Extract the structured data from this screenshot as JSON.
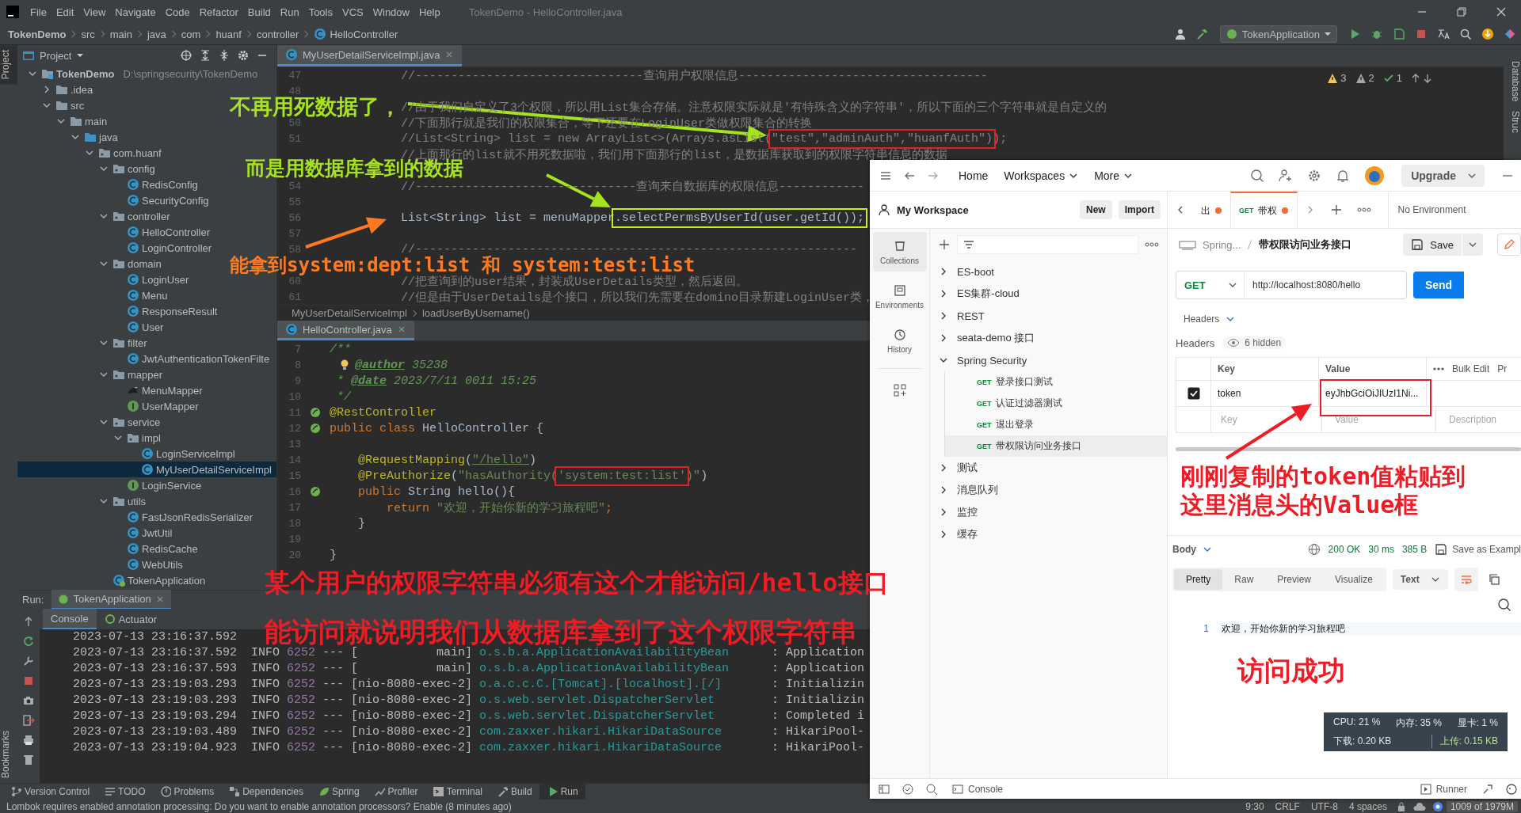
{
  "ide": {
    "menu": [
      "File",
      "Edit",
      "View",
      "Navigate",
      "Code",
      "Refactor",
      "Build",
      "Run",
      "Tools",
      "VCS",
      "Window",
      "Help"
    ],
    "window_title": "TokenDemo - HelloController.java",
    "breadcrumb": [
      "TokenDemo",
      "src",
      "main",
      "java",
      "com",
      "huanf",
      "controller",
      "HelloController"
    ],
    "run_config": "TokenApplication",
    "left_stripe": [
      {
        "label": "Project",
        "selected": true
      },
      {
        "label": "Bookmarks",
        "selected": false
      }
    ],
    "right_stripe": [
      "Database",
      "Struc"
    ],
    "project_panel": {
      "title": "Project",
      "tree": [
        {
          "name": "TokenDemo",
          "path": "D:\\springsecurity\\TokenDemo",
          "kind": "module",
          "expanded": true,
          "selected": false,
          "children": [
            {
              "name": ".idea",
              "kind": "folder",
              "expanded": false,
              "selected": false
            },
            {
              "name": "src",
              "kind": "folder",
              "expanded": true,
              "selected": false,
              "children": [
                {
                  "name": "main",
                  "kind": "folder",
                  "expanded": true,
                  "selected": false,
                  "children": [
                    {
                      "name": "java",
                      "kind": "source",
                      "expanded": true,
                      "selected": false,
                      "children": [
                        {
                          "name": "com.huanf",
                          "kind": "package",
                          "expanded": true,
                          "selected": false,
                          "children": [
                            {
                              "name": "config",
                              "kind": "package",
                              "expanded": true,
                              "selected": false,
                              "children": [
                                {
                                  "name": "RedisConfig",
                                  "kind": "class",
                                  "selected": false
                                },
                                {
                                  "name": "SecurityConfig",
                                  "kind": "class",
                                  "selected": false
                                }
                              ]
                            },
                            {
                              "name": "controller",
                              "kind": "package",
                              "expanded": true,
                              "selected": false,
                              "children": [
                                {
                                  "name": "HelloController",
                                  "kind": "class",
                                  "selected": false
                                },
                                {
                                  "name": "LoginController",
                                  "kind": "class",
                                  "selected": false
                                }
                              ]
                            },
                            {
                              "name": "domain",
                              "kind": "package",
                              "expanded": true,
                              "selected": false,
                              "children": [
                                {
                                  "name": "LoginUser",
                                  "kind": "class",
                                  "selected": false
                                },
                                {
                                  "name": "Menu",
                                  "kind": "class",
                                  "selected": false
                                },
                                {
                                  "name": "ResponseResult",
                                  "kind": "class",
                                  "selected": false
                                },
                                {
                                  "name": "User",
                                  "kind": "class",
                                  "selected": false
                                }
                              ]
                            },
                            {
                              "name": "filter",
                              "kind": "package",
                              "expanded": true,
                              "selected": false,
                              "children": [
                                {
                                  "name": "JwtAuthenticationTokenFilte",
                                  "kind": "class",
                                  "selected": false
                                }
                              ]
                            },
                            {
                              "name": "mapper",
                              "kind": "package",
                              "expanded": true,
                              "selected": false,
                              "children": [
                                {
                                  "name": "MenuMapper",
                                  "kind": "mapper",
                                  "selected": false
                                },
                                {
                                  "name": "UserMapper",
                                  "kind": "interface",
                                  "selected": false
                                }
                              ]
                            },
                            {
                              "name": "service",
                              "kind": "package",
                              "expanded": true,
                              "selected": false,
                              "children": [
                                {
                                  "name": "impl",
                                  "kind": "package",
                                  "expanded": true,
                                  "selected": false,
                                  "children": [
                                    {
                                      "name": "LoginServiceImpl",
                                      "kind": "class",
                                      "selected": false
                                    },
                                    {
                                      "name": "MyUserDetailServiceImpl",
                                      "kind": "class",
                                      "selected": true
                                    }
                                  ]
                                },
                                {
                                  "name": "LoginService",
                                  "kind": "interface",
                                  "selected": false
                                }
                              ]
                            },
                            {
                              "name": "utils",
                              "kind": "package",
                              "expanded": true,
                              "selected": false,
                              "children": [
                                {
                                  "name": "FastJsonRedisSerializer",
                                  "kind": "class",
                                  "selected": false
                                },
                                {
                                  "name": "JwtUtil",
                                  "kind": "class",
                                  "selected": false
                                },
                                {
                                  "name": "RedisCache",
                                  "kind": "class",
                                  "selected": false
                                },
                                {
                                  "name": "WebUtils",
                                  "kind": "class",
                                  "selected": false
                                }
                              ]
                            },
                            {
                              "name": "TokenApplication",
                              "kind": "app",
                              "selected": false
                            }
                          ]
                        }
                      ]
                    }
                  ]
                }
              ]
            }
          ]
        }
      ]
    },
    "editors": [
      {
        "tab": "MyUserDetailServiceImpl.java",
        "inspections": [
          {
            "kind": "warning",
            "count": "3"
          },
          {
            "kind": "weak",
            "count": "2"
          },
          {
            "kind": "ok",
            "count": "1"
          }
        ],
        "breadcrumb": [
          "MyUserDetailServiceImpl",
          "loadUserByUsername()"
        ],
        "lines": [
          {
            "kind": "code",
            "num": "47",
            "tokens": [
              {
                "kind": "comment",
                "text": "//--------------------------------查询用户权限信息-----------------------------------"
              }
            ]
          },
          {
            "kind": "code",
            "num": "48"
          },
          {
            "kind": "code",
            "tokens": [
              {
                "kind": "comment",
                "text": "//由于我们自定义了3个权限，所以用List集合存储。注意权限实际就是'有特殊含义的字符串'，所以下面的三个字符串就是自定义的"
              }
            ]
          },
          {
            "kind": "code",
            "num": "50",
            "tokens": [
              {
                "kind": "comment",
                "text": "//下面那行就是我们的权限集合，等下还要在LoginUser类做权限集合的转换"
              }
            ]
          },
          {
            "kind": "code",
            "num": "51",
            "tokens": [
              {
                "kind": "comment",
                "text": "//List<String> list = new ArrayList<>(Arrays.asList("
              },
              {
                "kind": "comment",
                "text": "\"test\",\"adminAuth\",\"huanfAuth\")",
                "color": "#e81e25"
              },
              {
                "kind": "comment",
                "text": ");"
              }
            ]
          },
          {
            "kind": "code",
            "tokens": [
              {
                "kind": "comment",
                "text": "//上面那行的list就不用死数据啦，我们用下面那行的list，是数据库获取到的权限字符串信息的数据"
              }
            ]
          },
          {
            "kind": "blank"
          },
          {
            "kind": "code",
            "num": "54",
            "tokens": [
              {
                "kind": "comment",
                "text": "//-------------------------------查询来自数据库的权限信息------------"
              }
            ]
          },
          {
            "kind": "code",
            "num": "55"
          },
          {
            "kind": "code",
            "num": "56",
            "tokens": [
              {
                "kind": "plain",
                "text": "List<String> list = menuMapper"
              },
              {
                "kind": "plain",
                "text": ".selectPermsByUserId(user.getId());",
                "color": "#c6f01a"
              }
            ]
          },
          {
            "kind": "code",
            "num": "57"
          },
          {
            "kind": "code",
            "num": "58",
            "tokens": [
              {
                "kind": "comment",
                "text": "//--------------------------------------------------------------"
              }
            ]
          },
          {
            "kind": "blank"
          },
          {
            "kind": "code",
            "num": "60",
            "tokens": [
              {
                "kind": "comment",
                "text": "//把查询到的user结果，封装成UserDetails类型，然后返回。"
              }
            ]
          },
          {
            "kind": "code",
            "num": "61",
            "tokens": [
              {
                "kind": "comment",
                "text": "//但是由于UserDetails是个接口，所以我们先需要在domino目录新建LoginUser类，"
              }
            ]
          }
        ]
      },
      {
        "tab": "HelloController.java",
        "lines": [
          {
            "kind": "code",
            "num": "7",
            "tokens": [
              {
                "kind": "doc",
                "text": "/**"
              }
            ]
          },
          {
            "kind": "code",
            "num": "8",
            "bulb": true,
            "tokens": [
              {
                "kind": "tag",
                "text": "@author"
              },
              {
                "kind": "doc",
                "text": " 35238"
              }
            ]
          },
          {
            "kind": "code",
            "num": "9",
            "tokens": [
              {
                "kind": "doc",
                "text": " * "
              },
              {
                "kind": "tag",
                "text": "@date"
              },
              {
                "kind": "doc",
                "text": " 2023/7/11 0011 15:25"
              }
            ]
          },
          {
            "kind": "code",
            "num": "10",
            "tokens": [
              {
                "kind": "doc",
                "text": " */"
              }
            ]
          },
          {
            "kind": "code",
            "num": "11",
            "bean": true,
            "tokens": [
              {
                "kind": "annotation",
                "text": "@RestController"
              }
            ]
          },
          {
            "kind": "code",
            "num": "12",
            "bean": true,
            "tokens": [
              {
                "kind": "keyword",
                "text": "public class "
              },
              {
                "kind": "plain",
                "text": "HelloController {"
              }
            ]
          },
          {
            "kind": "code",
            "num": "13"
          },
          {
            "kind": "code",
            "num": "14",
            "tokens": [
              {
                "kind": "annotation",
                "text": "    @RequestMapping"
              },
              {
                "kind": "plain",
                "text": "("
              },
              {
                "kind": "link",
                "text": "\"/hello\""
              },
              {
                "kind": "plain",
                "text": ")"
              }
            ]
          },
          {
            "kind": "code",
            "num": "15",
            "tokens": [
              {
                "kind": "annotation",
                "text": "    @PreAuthorize"
              },
              {
                "kind": "plain",
                "text": "("
              },
              {
                "kind": "string",
                "text": "\"hasAuthority("
              },
              {
                "kind": "string",
                "text": "'system:test:list'",
                "color": "#e81e25"
              },
              {
                "kind": "string",
                "text": ")\""
              },
              {
                "kind": "plain",
                "text": ")"
              }
            ]
          },
          {
            "kind": "code",
            "num": "16",
            "bean": true,
            "tokens": [
              {
                "kind": "keyword",
                "text": "    public "
              },
              {
                "kind": "plain",
                "text": "String hello(){"
              }
            ]
          },
          {
            "kind": "code",
            "num": "17",
            "tokens": [
              {
                "kind": "keyword",
                "text": "        return "
              },
              {
                "kind": "string",
                "text": "\"欢迎，开始你新的学习旅程吧\""
              },
              {
                "kind": "keyword",
                "text": ";"
              }
            ]
          },
          {
            "kind": "code",
            "num": "18",
            "tokens": [
              {
                "kind": "plain",
                "text": "    }"
              }
            ]
          },
          {
            "kind": "code",
            "num": "19"
          },
          {
            "kind": "code",
            "num": "20",
            "tokens": [
              {
                "kind": "plain",
                "text": "}"
              }
            ]
          }
        ]
      }
    ],
    "run_panel": {
      "title": "Run:",
      "tab": "TokenApplication",
      "tabs": [
        {
          "label": "Console",
          "selected": true
        },
        {
          "label": "Actuator",
          "selected": false
        }
      ],
      "log": [
        {
          "timestamp": "2023-07-13 23:16:37.592"
        },
        {
          "timestamp": "2023-07-13 23:16:37.592",
          "level": "INFO",
          "pid": "6252",
          "separator": "---",
          "thread": "[           main]",
          "logger": "o.s.b.a.ApplicationAvailabilityBean",
          "message": ": Application"
        },
        {
          "timestamp": "2023-07-13 23:16:37.593",
          "level": "INFO",
          "pid": "6252",
          "separator": "---",
          "thread": "[           main]",
          "logger": "o.s.b.a.ApplicationAvailabilityBean",
          "message": ": Application"
        },
        {
          "timestamp": "2023-07-13 23:19:03.293",
          "level": "INFO",
          "pid": "6252",
          "separator": "---",
          "thread": "[nio-8080-exec-2]",
          "logger": "o.a.c.c.C.[Tomcat].[localhost].[/]",
          "message": ": Initializin"
        },
        {
          "timestamp": "2023-07-13 23:19:03.293",
          "level": "INFO",
          "pid": "6252",
          "separator": "---",
          "thread": "[nio-8080-exec-2]",
          "logger": "o.s.web.servlet.DispatcherServlet",
          "message": ": Initializin"
        },
        {
          "timestamp": "2023-07-13 23:19:03.294",
          "level": "INFO",
          "pid": "6252",
          "separator": "---",
          "thread": "[nio-8080-exec-2]",
          "logger": "o.s.web.servlet.DispatcherServlet",
          "message": ": Completed i"
        },
        {
          "timestamp": "2023-07-13 23:19:03.489",
          "level": "INFO",
          "pid": "6252",
          "separator": "---",
          "thread": "[nio-8080-exec-2]",
          "logger": "com.zaxxer.hikari.HikariDataSource",
          "message": ": HikariPool-"
        },
        {
          "timestamp": "2023-07-13 23:19:04.923",
          "level": "INFO",
          "pid": "6252",
          "separator": "---",
          "thread": "[nio-8080-exec-2]",
          "logger": "com.zaxxer.hikari.HikariDataSource",
          "message": ": HikariPool-"
        }
      ]
    },
    "tool_windows": [
      {
        "label": "Version Control",
        "selected": false
      },
      {
        "label": "TODO",
        "selected": false
      },
      {
        "label": "Problems",
        "selected": false
      },
      {
        "label": "Dependencies",
        "selected": false
      },
      {
        "label": "Spring",
        "selected": false
      },
      {
        "label": "Profiler",
        "selected": false
      },
      {
        "label": "Terminal",
        "selected": false
      },
      {
        "label": "Build",
        "selected": false
      },
      {
        "label": "Run",
        "selected": true
      }
    ],
    "status_bar": {
      "message": "Lombok requires enabled annotation processing: Do you want to enable annotation processors? Enable (8 minutes ago)",
      "items": [
        "9:30",
        "CRLF",
        "UTF-8",
        "4 spaces"
      ],
      "memory": "1009 of 1979M"
    }
  },
  "postman": {
    "nav": [
      {
        "label": "Home",
        "kind": "link"
      },
      {
        "label": "Workspaces",
        "kind": "menu"
      },
      {
        "label": "More",
        "kind": "menu"
      }
    ],
    "upgrade": "Upgrade",
    "workspace": "My Workspace",
    "workspace_buttons": [
      "New",
      "Import"
    ],
    "sidebar": [
      {
        "label": "Collections",
        "selected": true
      },
      {
        "label": "Environments",
        "selected": false
      },
      {
        "label": "History",
        "selected": false
      }
    ],
    "collections": [
      {
        "name": "ES-boot",
        "expanded": false,
        "selected": false
      },
      {
        "name": "ES集群-cloud",
        "expanded": false,
        "selected": false
      },
      {
        "name": "REST",
        "expanded": false,
        "selected": false
      },
      {
        "name": "seata-demo 接口",
        "expanded": false,
        "selected": false
      },
      {
        "name": "Spring Security",
        "expanded": true,
        "selected": false,
        "children": [
          {
            "method": "GET",
            "name": "登录接口测试",
            "selected": false
          },
          {
            "method": "GET",
            "name": "认证过滤器测试",
            "selected": false
          },
          {
            "method": "GET",
            "name": "退出登录",
            "selected": false
          },
          {
            "method": "GET",
            "name": "带权限访问业务接口",
            "selected": true
          }
        ]
      },
      {
        "name": "测试",
        "expanded": false,
        "selected": false
      },
      {
        "name": "消息队列",
        "expanded": false,
        "selected": false
      },
      {
        "name": "监控",
        "expanded": false,
        "selected": false
      },
      {
        "name": "缓存",
        "expanded": false,
        "selected": false
      }
    ],
    "tabs": [
      {
        "label": "出",
        "unsaved": true,
        "selected": false
      },
      {
        "method": "GET",
        "label": "带权",
        "unsaved": true,
        "selected": true
      }
    ],
    "environment": "No Environment",
    "request": {
      "breadcrumb": [
        "Spring...",
        "带权限访问业务接口"
      ],
      "save": "Save",
      "method": "GET",
      "url": "http://localhost:8080/hello",
      "send": "Send",
      "section": "Headers",
      "headers_label": "Headers",
      "hidden": "6 hidden",
      "columns": [
        "Key",
        "Value"
      ],
      "bulk_edit": "Bulk Edit",
      "presets": "Pr",
      "rows": [
        {
          "checked": true,
          "key": "token",
          "value": "eyJhbGciOiJIUzI1Ni..."
        }
      ],
      "new_row": {
        "key": "Key",
        "value": "Value",
        "description": "Description"
      }
    },
    "response": {
      "view": "Body",
      "status": "200 OK",
      "time": "30 ms",
      "size": "385 B",
      "save_example": "Save as Exampl",
      "modes": [
        {
          "label": "Pretty",
          "selected": true
        },
        {
          "label": "Raw",
          "selected": false
        },
        {
          "label": "Preview",
          "selected": false
        },
        {
          "label": "Visualize",
          "selected": false
        }
      ],
      "format": "Text",
      "wrap": true,
      "lines": [
        {
          "num": "1",
          "text": "欢迎，开始你新的学习旅程吧"
        }
      ]
    },
    "footer": {
      "console": "Console",
      "runner": "Runner"
    }
  },
  "system_monitor": {
    "cpu": "CPU: 21 %",
    "memory": "内存: 35 %",
    "gpu": "显卡: 1 %",
    "download": "下载: 0.20 KB",
    "upload": "上传: 0.15 KB"
  },
  "annotations": [
    {
      "text": "不再用死数据了，",
      "color": "#a6e21e"
    },
    {
      "text": "而是用数据库拿到的数据",
      "color": "#a6e21e"
    },
    {
      "text": "能拿到system:dept:list 和 system:test:list",
      "color": "#ff7a1f"
    },
    {
      "text": "某个用户的权限字符串必须有这个才能访问/hello接口",
      "color": "#ee1c24"
    },
    {
      "text": "能访问就说明我们从数据库拿到了这个权限字符串",
      "color": "#ee1c24"
    },
    {
      "text": "刚刚复制的token值粘贴到这里消息头的Value框",
      "color": "#ee1c24"
    },
    {
      "text": "访问成功",
      "color": "#ee1c24"
    }
  ]
}
